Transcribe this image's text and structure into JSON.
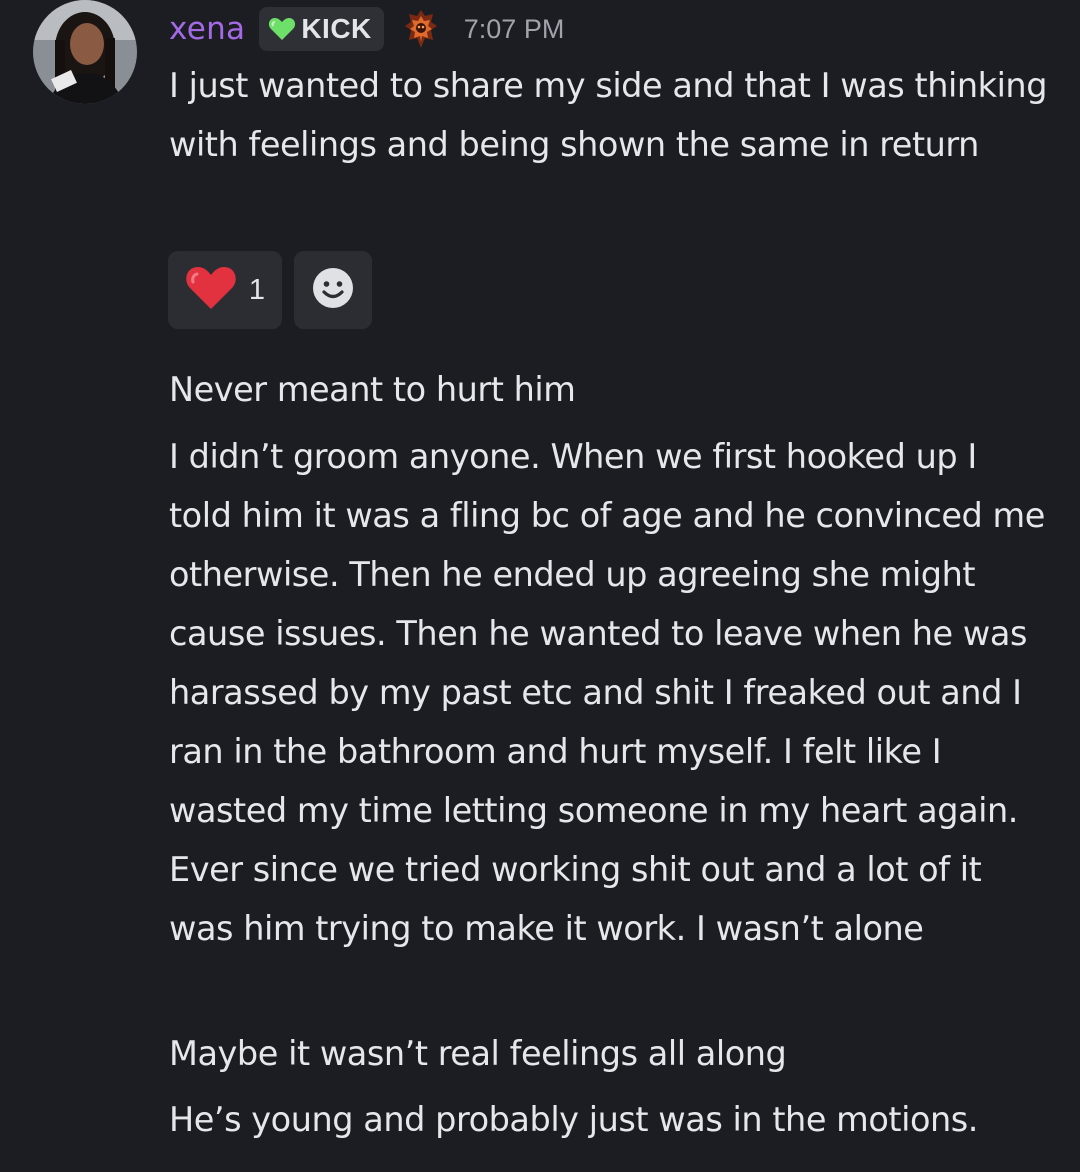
{
  "message": {
    "username": "xena",
    "tag_label": "KICK",
    "timestamp": "7:07 PM",
    "icons": {
      "avatar": "user-avatar-photo",
      "tag": "green-heart-icon",
      "role": "orange-crest-icon"
    },
    "colors": {
      "username": "#a46ae6",
      "tag_heart": "#6ee069",
      "role_icon": "#e06a2c",
      "heart_reaction": "#e2313f",
      "background": "#1c1d22"
    },
    "first_paragraph": "I just wanted to share my side and that I was thinking with feelings and being shown the same in return",
    "reactions": [
      {
        "emoji": "red-heart-icon",
        "count": "1"
      }
    ],
    "add_reaction_icon": "smiley-add-reaction-icon",
    "followups": [
      "Never meant to hurt him",
      "I didn’t groom anyone. When we first hooked up I told him it was a fling bc of age and he convinced me otherwise. Then he ended up agreeing she might cause issues. Then he wanted to leave when he was harassed by my past etc and shit I freaked out and I ran in the bathroom and hurt myself. I felt like I wasted my time letting someone in my heart again. Ever since we tried working shit out and a lot of it was him trying to make it work. I wasn’t alone",
      "Maybe it wasn’t real feelings all along",
      "He’s young and probably just was in the motions."
    ]
  }
}
